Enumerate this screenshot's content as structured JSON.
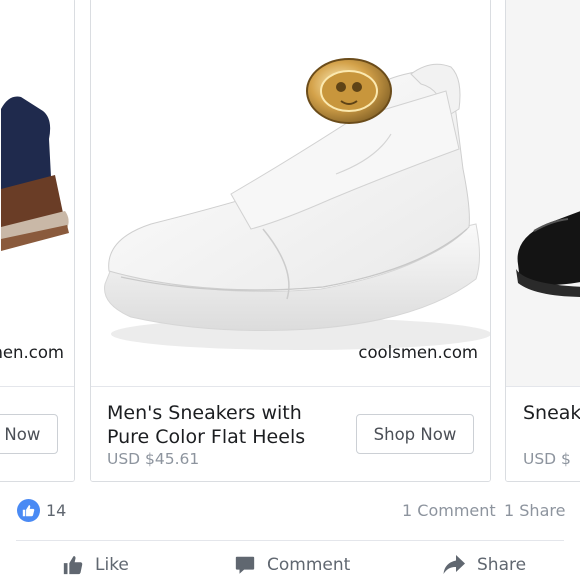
{
  "cards": [
    {
      "watermark": "coolsmen.com",
      "shop_label": "Shop Now"
    },
    {
      "watermark": "coolsmen.com",
      "title": "Men's Sneakers with Pure Color Flat Heels",
      "price": "USD $45.61",
      "shop_label": "Shop Now"
    },
    {
      "title": "Sneakers Men Leather",
      "price": "USD $"
    }
  ],
  "stats": {
    "reaction_icon": "thumbs-up-icon",
    "like_count": "14",
    "comments": "1 Comment",
    "shares": "1 Share"
  },
  "actions": {
    "like": "Like",
    "comment": "Comment",
    "share": "Share"
  },
  "colors": {
    "reaction_blue": "#4a8af4",
    "secondary_text": "#606770",
    "border": "#dadde1"
  }
}
